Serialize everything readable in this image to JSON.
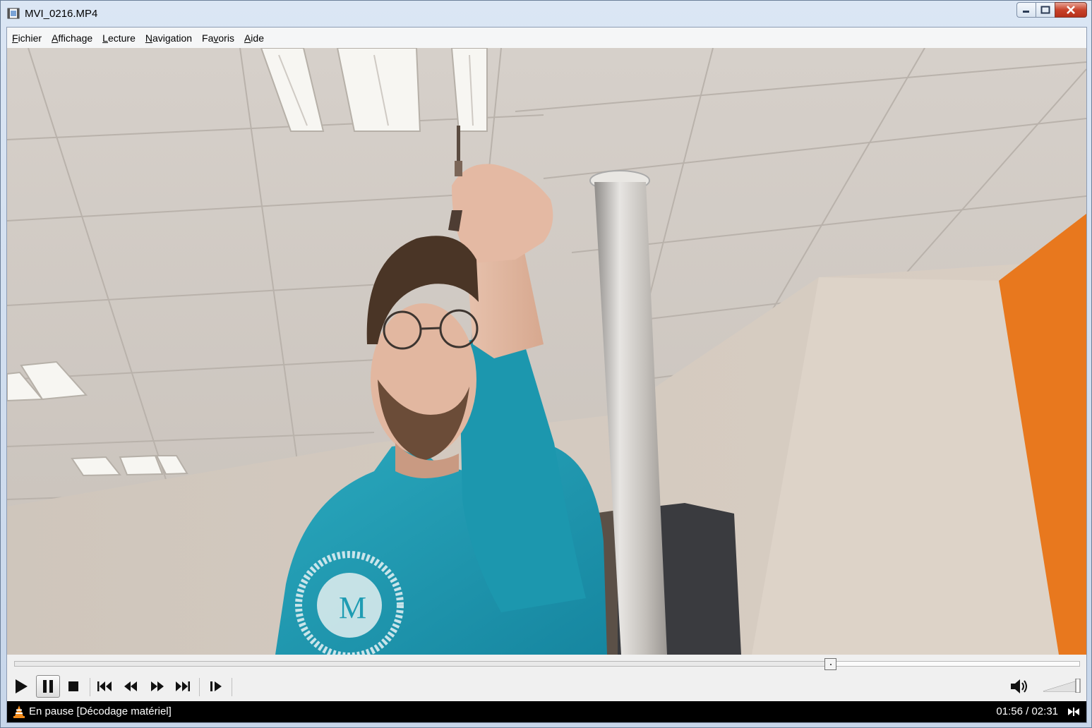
{
  "window": {
    "title": "MVI_0216.MP4",
    "controls": {
      "minimize": "minimize",
      "maximize": "maximize",
      "close": "close"
    }
  },
  "menu": [
    {
      "accel": "F",
      "rest": "ichier"
    },
    {
      "accel": "A",
      "rest": "ffichage"
    },
    {
      "accel": "L",
      "rest": "ecture"
    },
    {
      "accel": "N",
      "rest": "avigation"
    },
    {
      "pre": "Fa",
      "accel": "v",
      "rest": "oris"
    },
    {
      "accel": "A",
      "rest": "ide"
    }
  ],
  "player": {
    "progress": 0.766,
    "buttons": [
      {
        "name": "play-button",
        "icon": "play-icon"
      },
      {
        "name": "pause-button",
        "icon": "pause-icon",
        "active": true
      },
      {
        "name": "stop-button",
        "icon": "stop-icon"
      },
      {
        "name": "previous-button",
        "icon": "skip-back-icon"
      },
      {
        "name": "slower-button",
        "icon": "rewind-icon"
      },
      {
        "name": "faster-button",
        "icon": "fast-forward-icon"
      },
      {
        "name": "next-button",
        "icon": "skip-forward-icon"
      },
      {
        "name": "frame-step-button",
        "icon": "frame-step-icon"
      }
    ],
    "volume_level": 1.0,
    "volume_icon": "speaker-icon"
  },
  "status": {
    "text": "En pause [Décodage matériel]",
    "time": "01:56 / 02:31",
    "icon": "vlc-cone-icon",
    "extra_icon": "hardware-decode-icon"
  },
  "colors": {
    "accent_orange": "#e8781e",
    "hoodie": "#1f9cb3",
    "statusbar": "#000000"
  }
}
